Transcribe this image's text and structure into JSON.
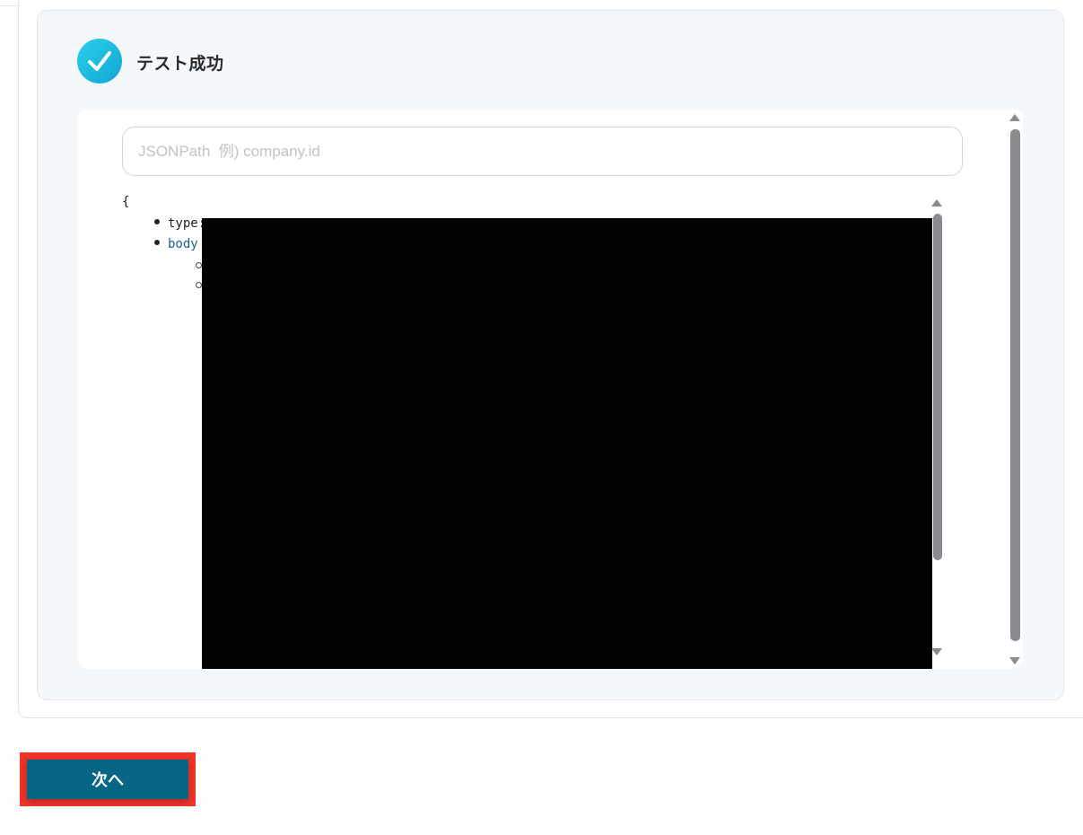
{
  "test_result": {
    "title": "テスト成功",
    "status_icon": "check-circle-icon",
    "accent_color": "#16b4de"
  },
  "jsonpath": {
    "placeholder": "JSONPath  例) company.id",
    "value": ""
  },
  "json_tree": {
    "open_brace": "{",
    "items": [
      {
        "key": "type",
        "text": "type:"
      },
      {
        "key": "body",
        "text": "body"
      }
    ]
  },
  "footer": {
    "next_label": "次へ",
    "button_color": "#086685",
    "highlight_color": "#f0342a"
  }
}
